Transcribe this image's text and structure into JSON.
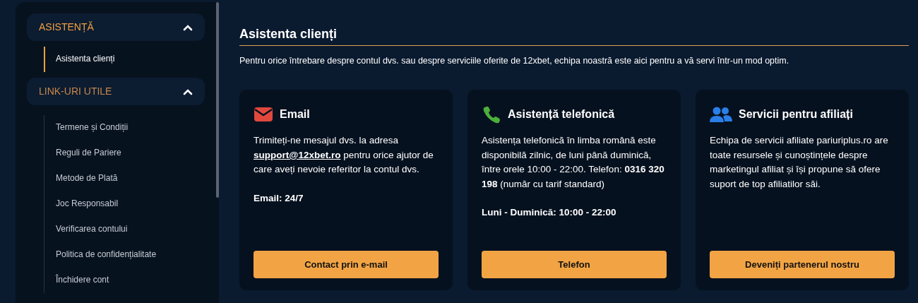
{
  "sidebar": {
    "sections": [
      {
        "title": "ASISTENȚĂ",
        "expanded": true,
        "active": true,
        "items": [
          {
            "label": "Asistenta clienți",
            "selected": true
          }
        ]
      },
      {
        "title": "LINK-URI UTILE",
        "expanded": true,
        "active": false,
        "items": [
          {
            "label": "Termene și Condiții",
            "selected": false
          },
          {
            "label": "Reguli de Pariere",
            "selected": false
          },
          {
            "label": "Metode de Plată",
            "selected": false
          },
          {
            "label": "Joc Responsabil",
            "selected": false
          },
          {
            "label": "Verificarea contului",
            "selected": false
          },
          {
            "label": "Politica de confidențialitate",
            "selected": false
          },
          {
            "label": "Închidere cont",
            "selected": false
          }
        ]
      }
    ]
  },
  "main": {
    "title": "Asistenta clienți",
    "description": "Pentru orice întrebare despre contul dvs. sau despre serviciile oferite de 12xbet, echipa noastră este aici pentru a vă servi într-un mod optim.",
    "cards": [
      {
        "kind": "email",
        "title": "Email",
        "text_before": "Trimiteți-ne mesajul dvs. la adresa",
        "link": "support@12xbet.ro",
        "text_after": "pentru orice ajutor de care aveți nevoie referitor la contul dvs.",
        "hours": "Email: 24/7",
        "button": "Contact prin e-mail"
      },
      {
        "kind": "phone",
        "title": "Asistență telefonică",
        "text_before": "Asistența telefonică în limba română este disponibilă zilnic, de luni până duminică, între orele 10:00 - 22:00. Telefon: **0316 320 198** (număr cu tarif standard)",
        "hours": "Luni - Duminică: 10:00 - 22:00",
        "button": "Telefon"
      },
      {
        "kind": "people",
        "title": "Servicii pentru afiliați",
        "text_before": "Echipa de servicii afiliate pariuriplus.ro are toate resursele și cunoștințele despre marketingul afiliat și își propune să ofere suport de top afiliatilor săi.",
        "button": "Deveniți partenerul nostru"
      }
    ]
  }
}
